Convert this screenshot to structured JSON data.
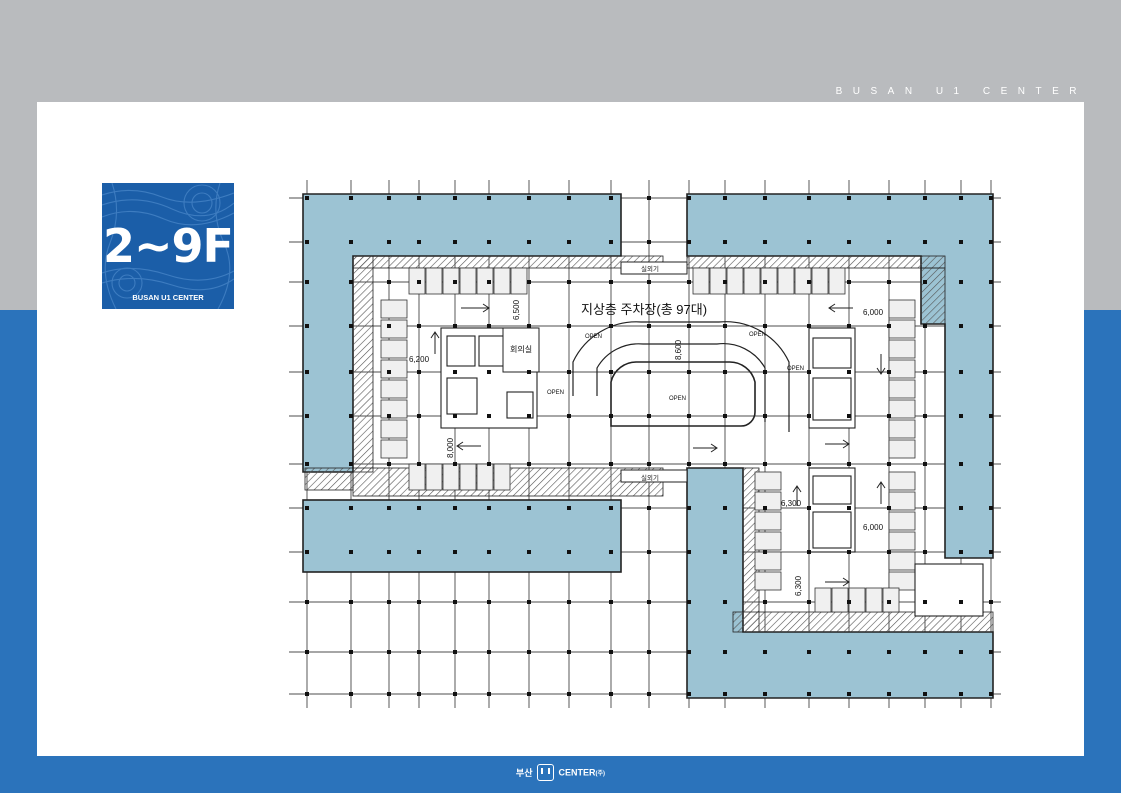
{
  "header": {
    "brand_strip": "BUSAN U1 CENTER"
  },
  "badge": {
    "floor": "2~9F",
    "name": "BUSAN U1 CENTER"
  },
  "plan": {
    "title": "지상층 주차장(총 97대)",
    "meeting_room": "회의실",
    "shower_room_top": "실외기",
    "shower_room_bottom": "실외기",
    "open_labels": [
      "OPEN",
      "OPEN",
      "OPEN",
      "OPEN",
      "OPEN"
    ],
    "dims": {
      "d6500": "6,500",
      "d6000_top": "6,000",
      "d6200": "6,200",
      "d8000": "8,000",
      "d8600": "8,600",
      "d6300_a": "6,300",
      "d6000_bottom": "6,000",
      "d6300_b": "6,300"
    },
    "colors": {
      "office": "#9cc3d3",
      "wall": "#222222",
      "hatch": "#555555",
      "grid": "#111111"
    }
  },
  "footer": {
    "korean": "부산",
    "center": "CENTER",
    "suffix": "(주)"
  }
}
